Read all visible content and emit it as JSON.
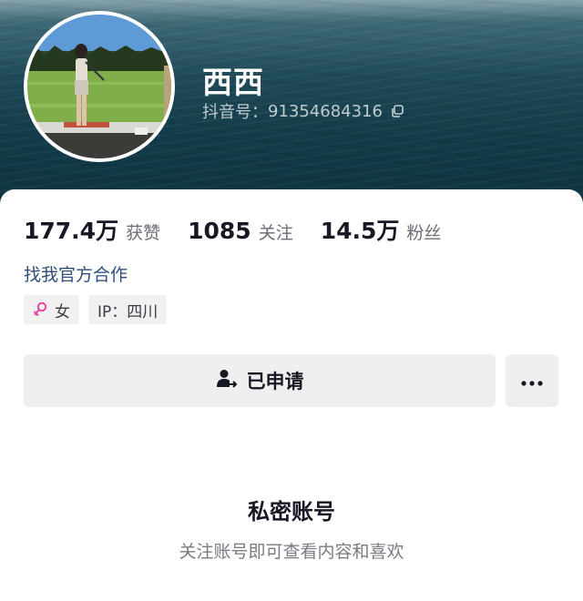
{
  "profile": {
    "username": "西西",
    "id_label": "抖音号：",
    "id_value": "91354684316"
  },
  "stats": [
    {
      "value": "177.4万",
      "label": "获赞"
    },
    {
      "value": "1085",
      "label": "关注"
    },
    {
      "value": "14.5万",
      "label": "粉丝"
    }
  ],
  "cooperation_link": "找我官方合作",
  "tags": {
    "gender": "女",
    "ip": "IP：四川"
  },
  "actions": {
    "applied_label": "已申请"
  },
  "private": {
    "title": "私密账号",
    "subtitle": "关注账号即可查看内容和喜欢"
  },
  "colors": {
    "header_dark": "#123a48",
    "link": "#2f4f7a",
    "female_icon": "#e7479c",
    "button_bg": "#efeff0"
  },
  "icons": {
    "copy": "copy-icon",
    "female": "female-icon",
    "user_applied": "user-arrow-icon",
    "more": "more-icon"
  }
}
